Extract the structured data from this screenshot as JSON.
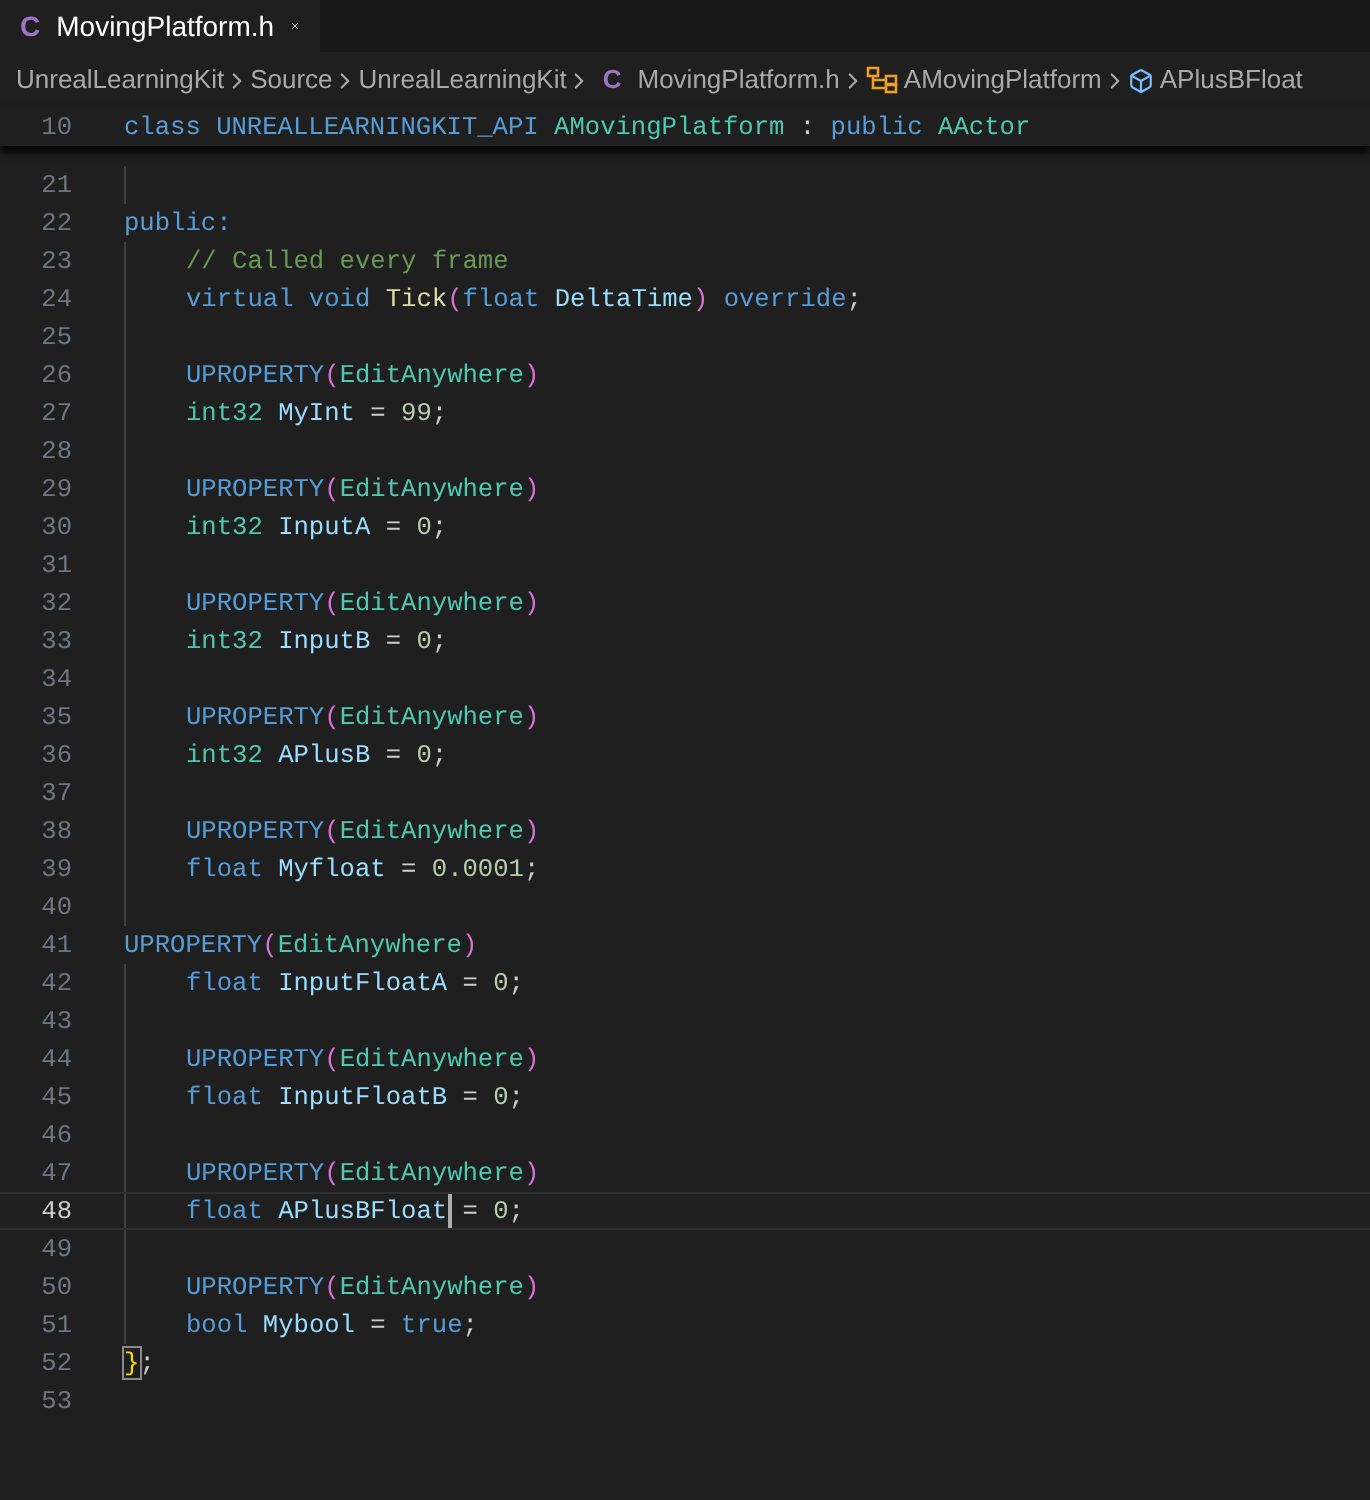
{
  "tab": {
    "icon": "C",
    "title": "MovingPlatform.h",
    "selected": true
  },
  "breadcrumbs": [
    {
      "kind": "folder",
      "text": "UnrealLearningKit"
    },
    {
      "kind": "folder",
      "text": "Source"
    },
    {
      "kind": "folder",
      "text": "UnrealLearningKit"
    },
    {
      "kind": "file",
      "icon": "C",
      "text": "MovingPlatform.h"
    },
    {
      "kind": "class",
      "text": "AMovingPlatform"
    },
    {
      "kind": "field",
      "text": "APlusBFloat"
    }
  ],
  "sticky_line": {
    "number": "10",
    "tokens": [
      {
        "kind": "kw",
        "text": "class "
      },
      {
        "kind": "kw",
        "text": "UNREALLEARNINGKIT_API "
      },
      {
        "kind": "type",
        "text": "AMovingPlatform"
      },
      {
        "kind": "plain",
        "text": " : "
      },
      {
        "kind": "kw",
        "text": "public "
      },
      {
        "kind": "type",
        "text": "AActor"
      }
    ]
  },
  "lines": [
    {
      "number": "21",
      "guide": true
    },
    {
      "number": "22",
      "guide": false,
      "tokens": [
        {
          "kind": "kw",
          "text": "public:"
        }
      ]
    },
    {
      "number": "23",
      "guide": true,
      "indented": true,
      "tokens": [
        {
          "kind": "com",
          "text": "// Called every frame"
        }
      ]
    },
    {
      "number": "24",
      "guide": true,
      "indented": true,
      "tokens": [
        {
          "kind": "kw",
          "text": "virtual void "
        },
        {
          "kind": "fn",
          "text": "Tick"
        },
        {
          "kind": "paren",
          "text": "("
        },
        {
          "kind": "kw",
          "text": "float "
        },
        {
          "kind": "var",
          "text": "DeltaTime"
        },
        {
          "kind": "paren",
          "text": ")"
        },
        {
          "kind": "kw",
          "text": " override"
        },
        {
          "kind": "plain",
          "text": ";"
        }
      ]
    },
    {
      "number": "25",
      "guide": true
    },
    {
      "number": "26",
      "guide": true,
      "indented": true,
      "tokens": [
        {
          "kind": "kw",
          "text": "UPROPERTY"
        },
        {
          "kind": "paren",
          "text": "("
        },
        {
          "kind": "type",
          "text": "EditAnywhere"
        },
        {
          "kind": "paren",
          "text": ")"
        }
      ]
    },
    {
      "number": "27",
      "guide": true,
      "indented": true,
      "tokens": [
        {
          "kind": "type",
          "text": "int32 "
        },
        {
          "kind": "var",
          "text": "MyInt"
        },
        {
          "kind": "plain",
          "text": " = "
        },
        {
          "kind": "num",
          "text": "99"
        },
        {
          "kind": "plain",
          "text": ";"
        }
      ]
    },
    {
      "number": "28",
      "guide": true
    },
    {
      "number": "29",
      "guide": true,
      "indented": true,
      "tokens": [
        {
          "kind": "kw",
          "text": "UPROPERTY"
        },
        {
          "kind": "paren",
          "text": "("
        },
        {
          "kind": "type",
          "text": "EditAnywhere"
        },
        {
          "kind": "paren",
          "text": ")"
        }
      ]
    },
    {
      "number": "30",
      "guide": true,
      "indented": true,
      "tokens": [
        {
          "kind": "type",
          "text": "int32 "
        },
        {
          "kind": "var",
          "text": "InputA"
        },
        {
          "kind": "plain",
          "text": " = "
        },
        {
          "kind": "num",
          "text": "0"
        },
        {
          "kind": "plain",
          "text": ";"
        }
      ]
    },
    {
      "number": "31",
      "guide": true
    },
    {
      "number": "32",
      "guide": true,
      "indented": true,
      "tokens": [
        {
          "kind": "kw",
          "text": "UPROPERTY"
        },
        {
          "kind": "paren",
          "text": "("
        },
        {
          "kind": "type",
          "text": "EditAnywhere"
        },
        {
          "kind": "paren",
          "text": ")"
        }
      ]
    },
    {
      "number": "33",
      "guide": true,
      "indented": true,
      "tokens": [
        {
          "kind": "type",
          "text": "int32 "
        },
        {
          "kind": "var",
          "text": "InputB"
        },
        {
          "kind": "plain",
          "text": " = "
        },
        {
          "kind": "num",
          "text": "0"
        },
        {
          "kind": "plain",
          "text": ";"
        }
      ]
    },
    {
      "number": "34",
      "guide": true
    },
    {
      "number": "35",
      "guide": true,
      "indented": true,
      "tokens": [
        {
          "kind": "kw",
          "text": "UPROPERTY"
        },
        {
          "kind": "paren",
          "text": "("
        },
        {
          "kind": "type",
          "text": "EditAnywhere"
        },
        {
          "kind": "paren",
          "text": ")"
        }
      ]
    },
    {
      "number": "36",
      "guide": true,
      "indented": true,
      "tokens": [
        {
          "kind": "type",
          "text": "int32 "
        },
        {
          "kind": "var",
          "text": "APlusB"
        },
        {
          "kind": "plain",
          "text": " = "
        },
        {
          "kind": "num",
          "text": "0"
        },
        {
          "kind": "plain",
          "text": ";"
        }
      ]
    },
    {
      "number": "37",
      "guide": true
    },
    {
      "number": "38",
      "guide": true,
      "indented": true,
      "tokens": [
        {
          "kind": "kw",
          "text": "UPROPERTY"
        },
        {
          "kind": "paren",
          "text": "("
        },
        {
          "kind": "type",
          "text": "EditAnywhere"
        },
        {
          "kind": "paren",
          "text": ")"
        }
      ]
    },
    {
      "number": "39",
      "guide": true,
      "indented": true,
      "tokens": [
        {
          "kind": "kw",
          "text": "float "
        },
        {
          "kind": "var",
          "text": "Myfloat"
        },
        {
          "kind": "plain",
          "text": " = "
        },
        {
          "kind": "num",
          "text": "0.0001"
        },
        {
          "kind": "plain",
          "text": ";"
        }
      ]
    },
    {
      "number": "40",
      "guide": true
    },
    {
      "number": "41",
      "guide": false,
      "tokens": [
        {
          "kind": "kw",
          "text": "UPROPERTY"
        },
        {
          "kind": "paren",
          "text": "("
        },
        {
          "kind": "type",
          "text": "EditAnywhere"
        },
        {
          "kind": "paren",
          "text": ")"
        }
      ]
    },
    {
      "number": "42",
      "guide": true,
      "indented": true,
      "tokens": [
        {
          "kind": "kw",
          "text": "float "
        },
        {
          "kind": "var",
          "text": "InputFloatA"
        },
        {
          "kind": "plain",
          "text": " = "
        },
        {
          "kind": "num",
          "text": "0"
        },
        {
          "kind": "plain",
          "text": ";"
        }
      ]
    },
    {
      "number": "43",
      "guide": true
    },
    {
      "number": "44",
      "guide": true,
      "indented": true,
      "tokens": [
        {
          "kind": "kw",
          "text": "UPROPERTY"
        },
        {
          "kind": "paren",
          "text": "("
        },
        {
          "kind": "type",
          "text": "EditAnywhere"
        },
        {
          "kind": "paren",
          "text": ")"
        }
      ]
    },
    {
      "number": "45",
      "guide": true,
      "indented": true,
      "tokens": [
        {
          "kind": "kw",
          "text": "float "
        },
        {
          "kind": "var",
          "text": "InputFloatB"
        },
        {
          "kind": "plain",
          "text": " = "
        },
        {
          "kind": "num",
          "text": "0"
        },
        {
          "kind": "plain",
          "text": ";"
        }
      ]
    },
    {
      "number": "46",
      "guide": true
    },
    {
      "number": "47",
      "guide": true,
      "indented": true,
      "tokens": [
        {
          "kind": "kw",
          "text": "UPROPERTY"
        },
        {
          "kind": "paren",
          "text": "("
        },
        {
          "kind": "type",
          "text": "EditAnywhere"
        },
        {
          "kind": "paren",
          "text": ")"
        }
      ]
    },
    {
      "number": "48",
      "guide": true,
      "indented": true,
      "current": true,
      "tokens": [
        {
          "kind": "kw",
          "text": "float "
        },
        {
          "kind": "var",
          "text": "APlusBFloat"
        },
        {
          "kind": "cursor"
        },
        {
          "kind": "plain",
          "text": " = "
        },
        {
          "kind": "num",
          "text": "0"
        },
        {
          "kind": "plain",
          "text": ";"
        }
      ]
    },
    {
      "number": "49",
      "guide": true
    },
    {
      "number": "50",
      "guide": true,
      "indented": true,
      "tokens": [
        {
          "kind": "kw",
          "text": "UPROPERTY"
        },
        {
          "kind": "paren",
          "text": "("
        },
        {
          "kind": "type",
          "text": "EditAnywhere"
        },
        {
          "kind": "paren",
          "text": ")"
        }
      ]
    },
    {
      "number": "51",
      "guide": true,
      "indented": true,
      "tokens": [
        {
          "kind": "kw",
          "text": "bool "
        },
        {
          "kind": "var",
          "text": "Mybool"
        },
        {
          "kind": "plain",
          "text": " = "
        },
        {
          "kind": "kw",
          "text": "true"
        },
        {
          "kind": "plain",
          "text": ";"
        }
      ]
    },
    {
      "number": "52",
      "guide": false,
      "tokens": [
        {
          "kind": "match",
          "text": "}"
        },
        {
          "kind": "plain",
          "text": ";"
        }
      ]
    },
    {
      "number": "53",
      "guide": false
    }
  ]
}
